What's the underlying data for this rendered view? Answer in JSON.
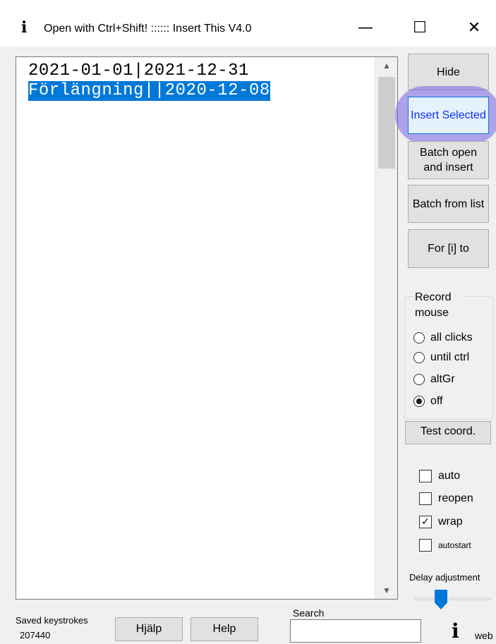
{
  "window": {
    "icon": "info-i-icon",
    "title": "Open with Ctrl+Shift! :::::: Insert This V4.0",
    "minimize_glyph": "—",
    "maximize_glyph": "☐",
    "close_glyph": "✕"
  },
  "editor": {
    "lines": [
      "2021-01-01|2021-12-31",
      "Förlängning||2020-12-08"
    ],
    "selected_line_index": 1
  },
  "buttons": {
    "hide": "Hide",
    "insert_selected": "Insert Selected",
    "batch_open": "Batch open and insert",
    "batch_list": "Batch from list",
    "for_i": "For [i] to",
    "test_coord": "Test coord."
  },
  "record_mouse": {
    "title": "Record mouse",
    "options": [
      {
        "label": "all clicks",
        "selected": false
      },
      {
        "label": "until ctrl",
        "selected": false
      },
      {
        "label": "altGr",
        "selected": false
      },
      {
        "label": "off",
        "selected": true
      }
    ]
  },
  "checkboxes": [
    {
      "label": "auto",
      "checked": false
    },
    {
      "label": "reopen",
      "checked": false
    },
    {
      "label": "wrap",
      "checked": true
    },
    {
      "label": "autostart",
      "checked": false
    }
  ],
  "delay": {
    "label": "Delay adjustment"
  },
  "bottom": {
    "saved_label": "Saved keystrokes",
    "saved_value": "207440",
    "hjalp": "Hjälp",
    "help": "Help",
    "search_label": "Search",
    "search_value": "",
    "web_text": "web"
  },
  "colors": {
    "selection": "#0078d7",
    "highlight": "#7864e6",
    "focus_border": "#0078d7"
  }
}
